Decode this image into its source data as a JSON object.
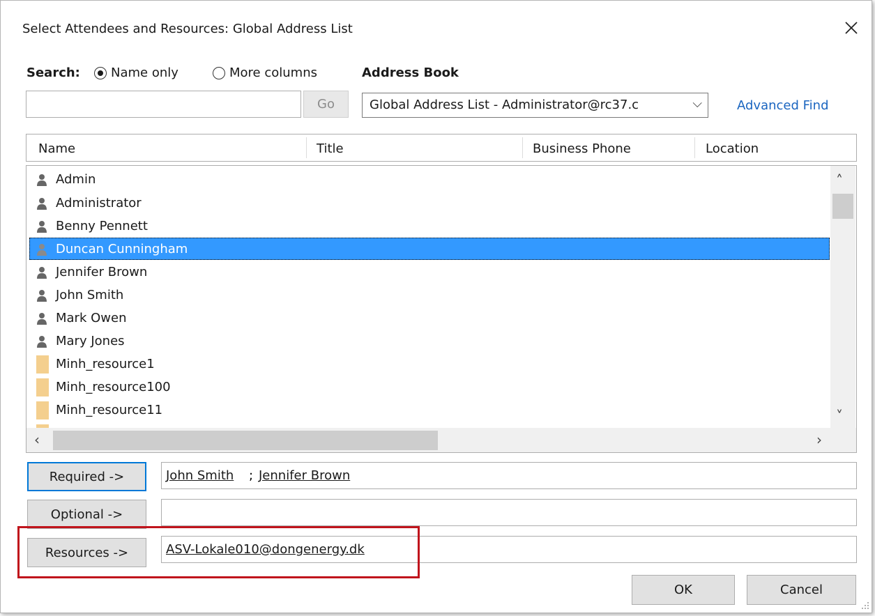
{
  "window": {
    "title": "Select Attendees and Resources: Global Address List"
  },
  "search": {
    "label": "Search:",
    "options": [
      "Name only",
      "More columns"
    ],
    "selected": "Name only",
    "input_value": "",
    "go_label": "Go"
  },
  "address_book": {
    "label": "Address Book",
    "selected": "Global Address List - Administrator@rc37.c",
    "advanced_find": "Advanced Find"
  },
  "table": {
    "columns": [
      "Name",
      "Title",
      "Business Phone",
      "Location"
    ],
    "rows": [
      {
        "name": "Admin",
        "type": "person"
      },
      {
        "name": "Administrator",
        "type": "person"
      },
      {
        "name": "Benny Pennett",
        "type": "person"
      },
      {
        "name": "Duncan Cunningham",
        "type": "person",
        "selected": true
      },
      {
        "name": "Jennifer  Brown",
        "type": "person"
      },
      {
        "name": "John Smith",
        "type": "person"
      },
      {
        "name": "Mark Owen",
        "type": "person"
      },
      {
        "name": "Mary Jones",
        "type": "person"
      },
      {
        "name": "Minh_resource1",
        "type": "resource"
      },
      {
        "name": "Minh_resource100",
        "type": "resource"
      },
      {
        "name": "Minh_resource11",
        "type": "resource"
      }
    ]
  },
  "recipients": {
    "required_label": "Required ->",
    "required_value_1": "John Smith",
    "required_sep": ";",
    "required_value_2": "Jennifer  Brown",
    "optional_label": "Optional ->",
    "optional_value": "",
    "resources_label": "Resources ->",
    "resources_value": "ASV-Lokale010@dongenergy.dk"
  },
  "buttons": {
    "ok": "OK",
    "cancel": "Cancel"
  },
  "colors": {
    "selection": "#3399ff",
    "link": "#1a65c0",
    "highlight_box": "#c0141c",
    "focus_border": "#0078d7"
  }
}
